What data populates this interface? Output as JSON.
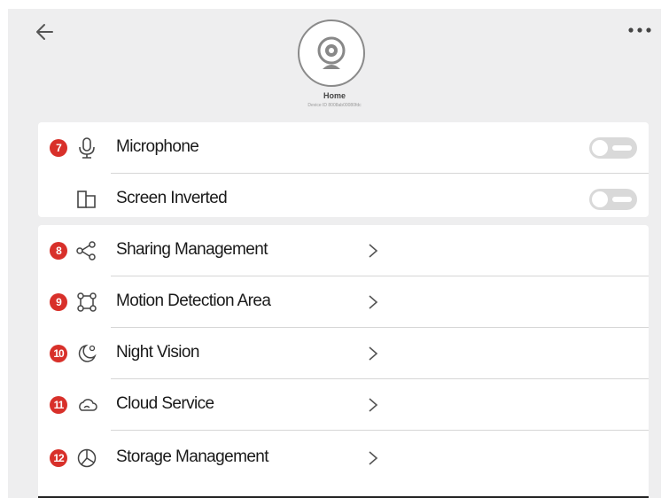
{
  "header": {
    "device_name": "Home",
    "device_id": "Device ID 8008ab00080fdc"
  },
  "general_settings": [
    {
      "label": "Microphone",
      "icon": "microphone-icon",
      "badge": "7",
      "enabled": false
    },
    {
      "label": "Screen Inverted",
      "icon": "screen-invert-icon",
      "badge": "",
      "enabled": false
    }
  ],
  "management_settings": [
    {
      "label": "Sharing Management",
      "icon": "share-icon",
      "badge": "8"
    },
    {
      "label": "Motion Detection Area",
      "icon": "motion-area-icon",
      "badge": "9"
    },
    {
      "label": "Night Vision",
      "icon": "night-vision-icon",
      "badge": "10"
    },
    {
      "label": "Cloud Service",
      "icon": "cloud-icon",
      "badge": "11"
    },
    {
      "label": "Storage Management",
      "icon": "storage-icon",
      "badge": "12"
    }
  ],
  "colors": {
    "badge": "#d8302a",
    "background": "#eeeeef",
    "card": "#ffffff",
    "toggle_off": "#d9d9d9"
  }
}
